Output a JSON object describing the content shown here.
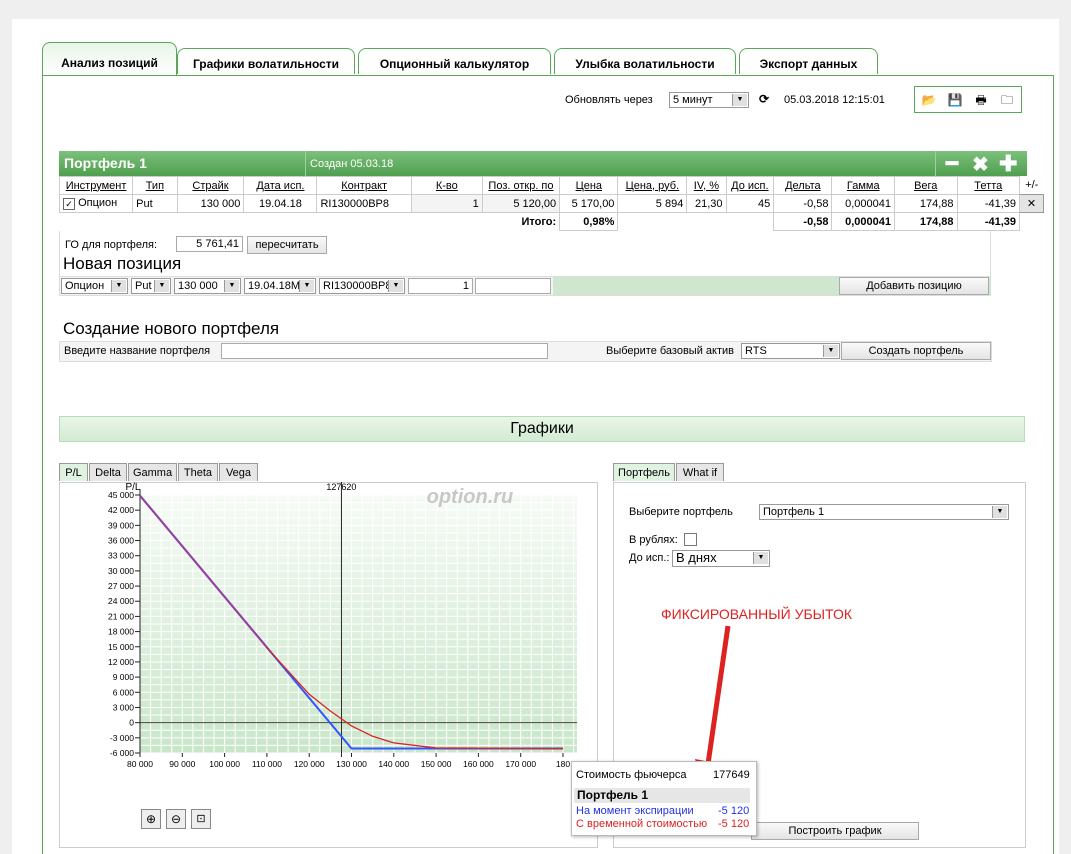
{
  "tabs": [
    "Анализ позиций",
    "Графики волатильности",
    "Опционный калькулятор",
    "Улыбка волатильности",
    "Экспорт данных"
  ],
  "refresh": {
    "label": "Обновлять через",
    "value": "5 минут",
    "datetime": "05.03.2018 12:15:01"
  },
  "portfolio": {
    "title": "Портфель 1",
    "created": "Создан 05.03.18"
  },
  "table": {
    "headers": [
      "Инструмент",
      "Тип",
      "Страйк",
      "Дата исп.",
      "Контракт",
      "К-во",
      "Поз. откр. по",
      "Цена",
      "Цена, руб.",
      "IV, %",
      "До исп.",
      "Дельта",
      "Гамма",
      "Вега",
      "Тетта",
      "+/-"
    ],
    "row": [
      "Опцион",
      "Put",
      "130 000",
      "19.04.18",
      "RI130000BP8",
      "1",
      "5 120,00",
      "5 170,00",
      "5 894",
      "21,30",
      "45",
      "-0,58",
      "0,000041",
      "174,88",
      "-41,39"
    ],
    "totals_label": "Итого:",
    "totals_pct": "0,98%",
    "totals": [
      "-0,58",
      "0,000041",
      "174,88",
      "-41,39"
    ]
  },
  "go": {
    "label": "ГО для портфеля:",
    "value": "5 761,41",
    "recalc": "пересчитать"
  },
  "new_position": {
    "title": "Новая позиция",
    "instrument": "Опцион",
    "type": "Put",
    "strike": "130 000",
    "date": "19.04.18M",
    "contract": "RI130000BP8",
    "qty": "1",
    "add": "Добавить позицию"
  },
  "new_portfolio": {
    "title": "Создание нового портфеля",
    "name_label": "Введите название портфеля",
    "asset_label": "Выберите базовый актив",
    "asset": "RTS",
    "create": "Создать портфель"
  },
  "charts_title": "Графики",
  "chart_tabs": [
    "P/L",
    "Delta",
    "Gamma",
    "Theta",
    "Vega"
  ],
  "right_tabs": [
    "Портфель",
    "What if"
  ],
  "right_panel": {
    "select_label": "Выберите портфель",
    "select_value": "Портфель 1",
    "rub_label": "В рублях:",
    "exp_label": "До исп.:",
    "exp_value": "В днях",
    "build": "Построить график"
  },
  "annotation": "ФИКСИРОВАННЫЙ УБЫТОК",
  "tooltip": {
    "fut_label": "Стоимость фьючерса",
    "fut_value": "177649",
    "title": "Портфель 1",
    "line1_label": "На момент экспирации",
    "line1_value": "-5 120",
    "line2_label": "С временной стоимостью",
    "line2_value": "-5 120"
  },
  "watermark": "option.ru",
  "chart_data": {
    "type": "line",
    "ylabel": "P/L",
    "marker_x": 127620,
    "marker_label": "127620",
    "xlim": [
      80000,
      180000
    ],
    "ylim": [
      -6000,
      45000
    ],
    "x_ticks": [
      "80 000",
      "90 000",
      "100 000",
      "110 000",
      "120 000",
      "130 000",
      "140 000",
      "150 000",
      "160 000",
      "170 000",
      "180"
    ],
    "y_ticks": [
      "45 000",
      "42 000",
      "39 000",
      "36 000",
      "33 000",
      "30 000",
      "27 000",
      "24 000",
      "21 000",
      "18 000",
      "15 000",
      "12 000",
      "9 000",
      "6 000",
      "3 000",
      "0",
      "-3 000",
      "-6 000"
    ],
    "series": [
      {
        "name": "На момент экспирации",
        "color": "#3355ff",
        "x": [
          80000,
          130000,
          180000
        ],
        "y": [
          44880,
          -5120,
          -5120
        ]
      },
      {
        "name": "С временной стоимостью",
        "color": "#dd2222",
        "x": [
          80000,
          110000,
          120000,
          125000,
          130000,
          135000,
          140000,
          150000,
          180000
        ],
        "y": [
          44880,
          14800,
          5600,
          2300,
          -650,
          -2700,
          -4000,
          -5000,
          -5120
        ]
      }
    ]
  },
  "colors": {
    "accent": "#58a858",
    "annotation": "#dd2222"
  }
}
